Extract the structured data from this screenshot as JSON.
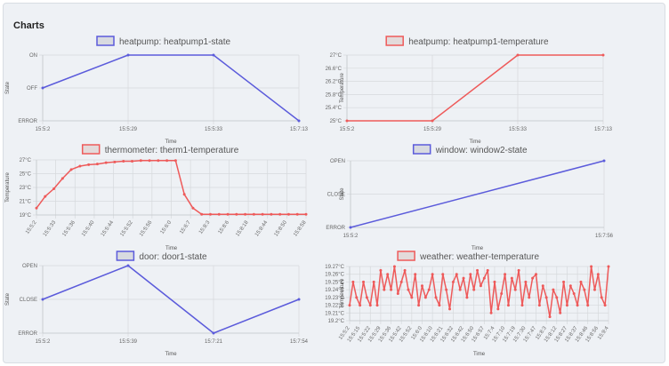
{
  "section_title": "Charts",
  "colors": {
    "blue": "#5b5bdb",
    "red": "#ee5a5a"
  },
  "chart_data": [
    {
      "id": "c1",
      "type": "line",
      "title": "heatpump: heatpump1-state",
      "color": "blue",
      "xlabel": "Time",
      "ylabel": "State",
      "categories": [
        "15:5:2",
        "15:5:29",
        "15:5:33",
        "15:7:13"
      ],
      "y_categories": [
        "ERROR",
        "OFF",
        "ON"
      ],
      "values": [
        "OFF",
        "ON",
        "ON",
        "ERROR"
      ]
    },
    {
      "id": "c2",
      "type": "line",
      "title": "heatpump: heatpump1-temperature",
      "color": "red",
      "xlabel": "Time",
      "ylabel": "Temperature",
      "categories": [
        "15:5:2",
        "15:5:29",
        "15:5:33",
        "15:7:13"
      ],
      "y_ticks": [
        "25°C",
        "25.4°C",
        "25.8°C",
        "26.2°C",
        "26.6°C",
        "27°C"
      ],
      "ylim": [
        25,
        27
      ],
      "values": [
        25,
        25,
        27,
        27
      ]
    },
    {
      "id": "c3",
      "type": "line",
      "title": "thermometer: therm1-temperature",
      "color": "red",
      "xlabel": "Time",
      "ylabel": "Temperature",
      "x_tick_labels": [
        "15:5:2",
        "15:5:33",
        "15:5:36",
        "15:5:40",
        "15:5:44",
        "15:5:52",
        "15:5:56",
        "15:6:0",
        "15:6:7",
        "15:8:3",
        "15:8:6",
        "15:8:18",
        "15:8:44",
        "15:8:50",
        "15:8:58"
      ],
      "y_ticks": [
        "19°C",
        "21°C",
        "23°C",
        "25°C",
        "27°C"
      ],
      "ylim": [
        19,
        27
      ],
      "values": [
        20,
        21.7,
        22.8,
        24.3,
        25.6,
        26.1,
        26.3,
        26.4,
        26.6,
        26.7,
        26.8,
        26.8,
        26.9,
        26.9,
        26.9,
        26.9,
        26.9,
        22,
        20,
        19.1,
        19.1,
        19.1,
        19.1,
        19.1,
        19.1,
        19.1,
        19.1,
        19.1,
        19.1,
        19.1,
        19.1,
        19.1
      ]
    },
    {
      "id": "c4",
      "type": "line",
      "title": "window: window2-state",
      "color": "blue",
      "xlabel": "Time",
      "ylabel": "State",
      "categories": [
        "15:5:2",
        "15:7:56"
      ],
      "y_categories": [
        "ERROR",
        "CLOSE",
        "OPEN"
      ],
      "values": [
        "ERROR",
        "OPEN"
      ]
    },
    {
      "id": "c5",
      "type": "line",
      "title": "door: door1-state",
      "color": "blue",
      "xlabel": "Time",
      "ylabel": "State",
      "categories": [
        "15:5:2",
        "15:5:39",
        "15:7:21",
        "15:7:54"
      ],
      "y_categories": [
        "ERROR",
        "CLOSE",
        "OPEN"
      ],
      "values": [
        "CLOSE",
        "OPEN",
        "ERROR",
        "CLOSE"
      ]
    },
    {
      "id": "c6",
      "type": "line",
      "title": "weather: weather-temperature",
      "color": "red",
      "xlabel": "Time",
      "ylabel": "Temperature",
      "x_tick_labels": [
        "15:5:2",
        "15:5:15",
        "15:5:22",
        "15:5:29",
        "15:5:36",
        "15:5:42",
        "15:5:52",
        "15:6:0",
        "15:6:10",
        "15:6:21",
        "15:6:32",
        "15:6:42",
        "15:6:50",
        "15:6:57",
        "15:7:4",
        "15:7:10",
        "15:7:19",
        "15:7:30",
        "15:7:47",
        "15:8:3",
        "15:8:12",
        "15:8:27",
        "15:8:37",
        "15:8:46",
        "15:8:56",
        "15:9:4"
      ],
      "y_ticks": [
        "19.2°C",
        "19.21°C",
        "19.22°C",
        "19.23°C",
        "19.24°C",
        "19.25°C",
        "19.26°C",
        "19.27°C"
      ],
      "ylim": [
        19.2,
        19.27
      ],
      "values": [
        19.22,
        19.25,
        19.23,
        19.22,
        19.25,
        19.23,
        19.22,
        19.25,
        19.22,
        19.265,
        19.24,
        19.26,
        19.24,
        19.27,
        19.235,
        19.25,
        19.265,
        19.24,
        19.23,
        19.26,
        19.22,
        19.245,
        19.23,
        19.24,
        19.26,
        19.23,
        19.22,
        19.26,
        19.24,
        19.215,
        19.25,
        19.26,
        19.24,
        19.255,
        19.23,
        19.26,
        19.24,
        19.265,
        19.245,
        19.255,
        19.265,
        19.21,
        19.25,
        19.215,
        19.235,
        19.26,
        19.22,
        19.255,
        19.24,
        19.265,
        19.22,
        19.25,
        19.23,
        19.255,
        19.26,
        19.22,
        19.245,
        19.23,
        19.205,
        19.24,
        19.23,
        19.21,
        19.25,
        19.22,
        19.245,
        19.235,
        19.22,
        19.25,
        19.24,
        19.22,
        19.27,
        19.24,
        19.26,
        19.23,
        19.22,
        19.27
      ]
    }
  ]
}
